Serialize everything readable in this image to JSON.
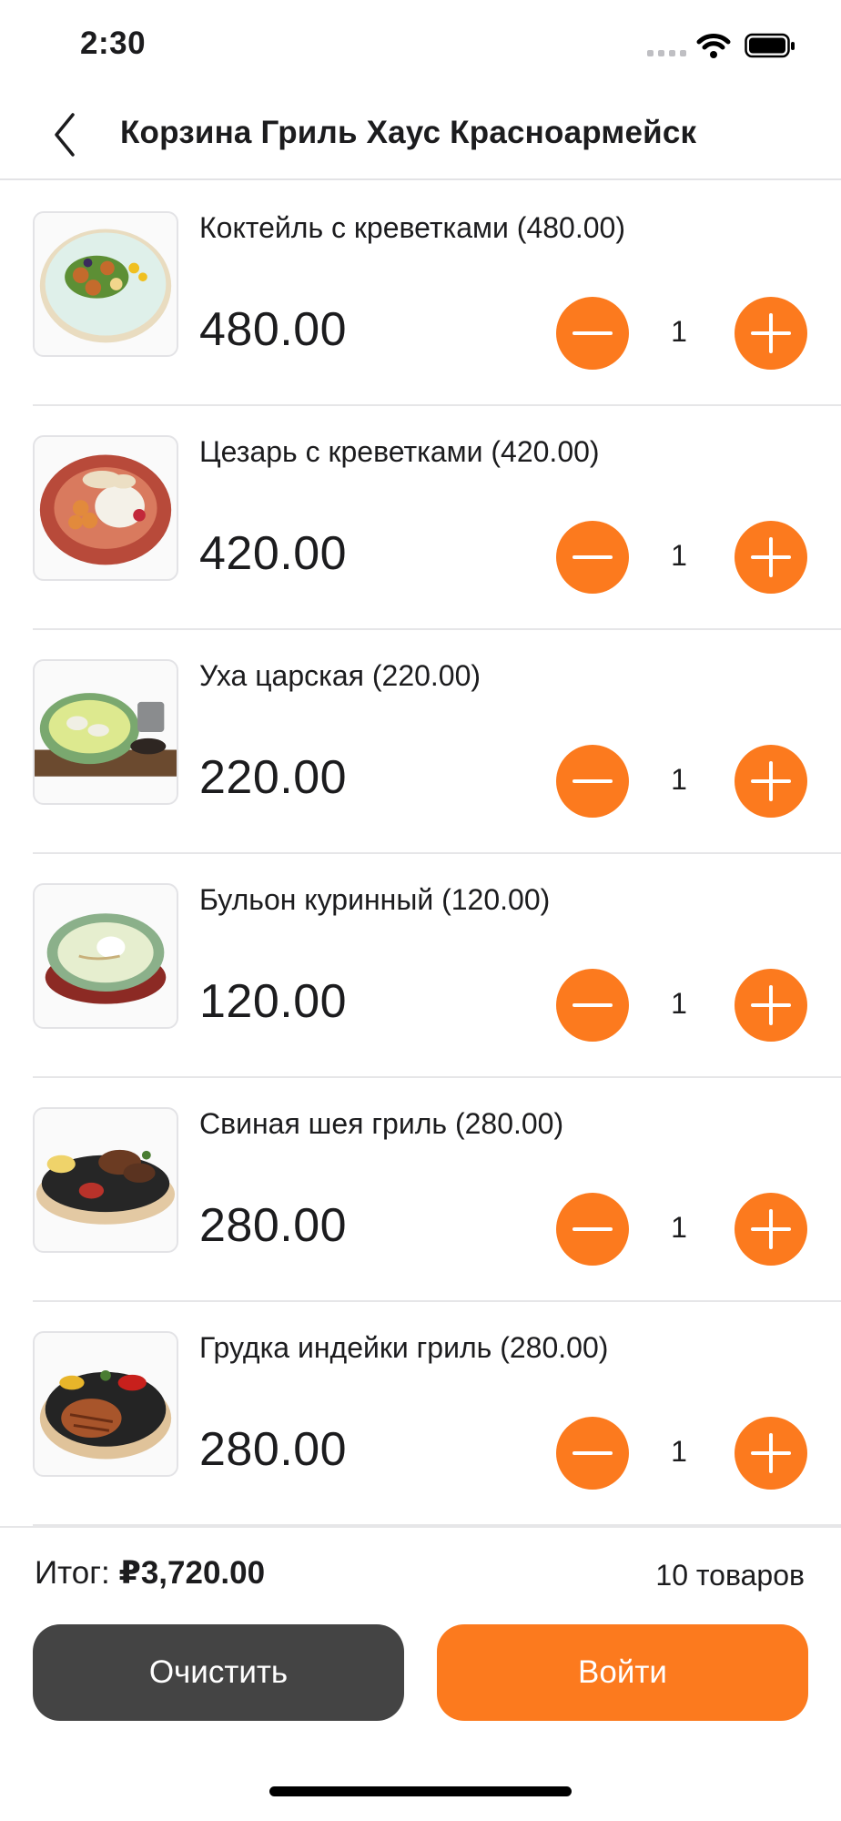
{
  "status": {
    "time": "2:30"
  },
  "nav": {
    "title": "Корзина Гриль Хаус Красноармейск",
    "back_icon": "chevron-left-icon"
  },
  "items": [
    {
      "name": "Коктейль с креветками (480.00)",
      "price": "480.00",
      "qty": "1"
    },
    {
      "name": "Цезарь с креветками (420.00)",
      "price": "420.00",
      "qty": "1"
    },
    {
      "name": "Уха царская (220.00)",
      "price": "220.00",
      "qty": "1"
    },
    {
      "name": "Бульон куринный (120.00)",
      "price": "120.00",
      "qty": "1"
    },
    {
      "name": "Свиная шея гриль (280.00)",
      "price": "280.00",
      "qty": "1"
    },
    {
      "name": "Грудка индейки гриль (280.00)",
      "price": "280.00",
      "qty": "1"
    }
  ],
  "footer": {
    "total_prefix": "Итог:",
    "total_value": "₽3,720.00",
    "count": "10 товаров",
    "clear_label": "Очистить",
    "login_label": "Войти"
  },
  "colors": {
    "accent": "#fc7a1e",
    "dark_button": "#444444",
    "divider": "#e6e6e8"
  }
}
